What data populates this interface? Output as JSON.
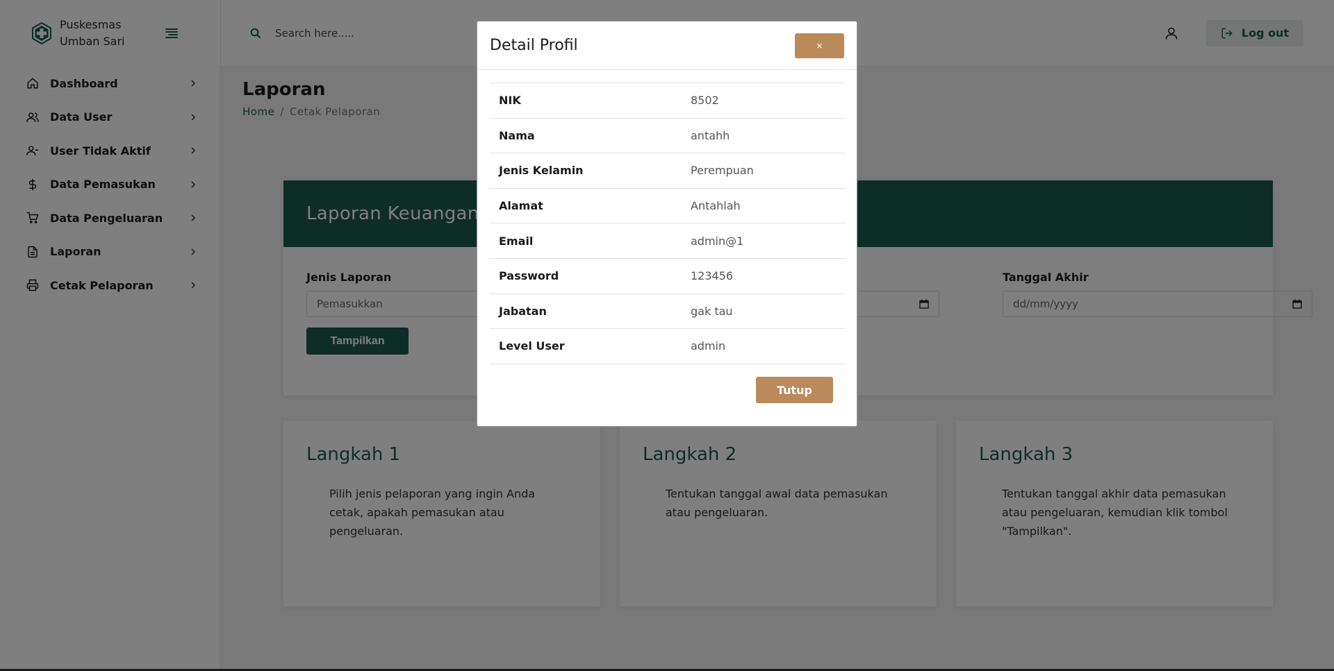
{
  "brand": {
    "name": "Puskesmas Umban Sari"
  },
  "sidebar": {
    "items": [
      {
        "label": "Dashboard",
        "icon": "home-icon"
      },
      {
        "label": "Data User",
        "icon": "users-icon"
      },
      {
        "label": "User Tidak Aktif",
        "icon": "user-minus-icon"
      },
      {
        "label": "Data Pemasukan",
        "icon": "dollar-icon"
      },
      {
        "label": "Data Pengeluaran",
        "icon": "cart-icon"
      },
      {
        "label": "Laporan",
        "icon": "document-icon"
      },
      {
        "label": "Cetak Pelaporan",
        "icon": "printer-icon"
      }
    ]
  },
  "header": {
    "search_placeholder": "Search here.....",
    "logout_label": "Log out"
  },
  "page": {
    "title": "Laporan",
    "breadcrumb": {
      "home": "Home",
      "separator": "/",
      "current": "Cetak Pelaporan"
    }
  },
  "report": {
    "title": "Laporan Keuangan",
    "jenis_label": "Jenis Laporan",
    "jenis_value": "Pemasukkan",
    "tanggal_akhir_label": "Tanggal Akhir",
    "tanggal_placeholder": "dd/mm/yyyy",
    "submit_label": "Tampilkan"
  },
  "steps": [
    {
      "title": "Langkah 1",
      "text": "Pilih jenis pelaporan yang ingin Anda cetak, apakah pemasukan atau pengeluaran."
    },
    {
      "title": "Langkah 2",
      "text": "Tentukan tanggal awal data pemasukan atau pengeluaran."
    },
    {
      "title": "Langkah 3",
      "text": "Tentukan tanggal akhir data pemasukan atau pengeluaran, kemudian klik tombol \"Tampilkan\"."
    }
  ],
  "modal": {
    "title": "Detail Profil",
    "close_symbol": "×",
    "footer_button": "Tutup",
    "rows": [
      {
        "key": "NIK",
        "value": "8502"
      },
      {
        "key": "Nama",
        "value": "antahh"
      },
      {
        "key": "Jenis Kelamin",
        "value": "Perempuan"
      },
      {
        "key": "Alamat",
        "value": "Antahlah"
      },
      {
        "key": "Email",
        "value": "admin@1"
      },
      {
        "key": "Password",
        "value": "123456"
      },
      {
        "key": "Jabatan",
        "value": "gak tau"
      },
      {
        "key": "Level User",
        "value": "admin"
      }
    ]
  },
  "colors": {
    "primary": "#1c5a4e",
    "accent": "#bb8a5a",
    "overlay": "rgba(0,0,0,0.5)"
  }
}
